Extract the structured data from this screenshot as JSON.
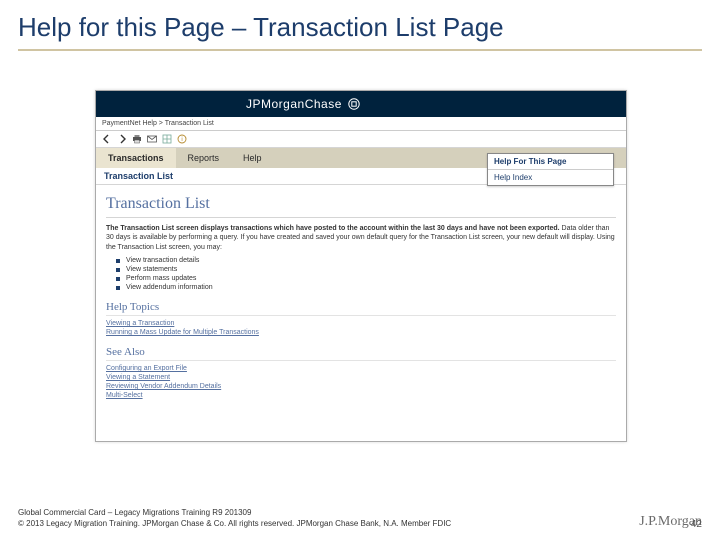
{
  "slide": {
    "title": "Help for this Page – Transaction List Page",
    "page_number": "42",
    "footer_line1": "Global Commercial Card – Legacy Migrations Training R9 201309",
    "footer_line2": "© 2013 Legacy Migration Training. JPMorgan Chase & Co. All rights reserved. JPMorgan Chase Bank, N.A. Member FDIC",
    "footer_logo": "J.P.Morgan"
  },
  "brand": {
    "text": "JPMorganChase"
  },
  "breadcrumb": "PaymentNet Help > Transaction List",
  "nav": {
    "tabs": [
      "Transactions",
      "Reports",
      "Help"
    ],
    "subtab": "Transaction List"
  },
  "help_menu": {
    "items": [
      "Help For This Page",
      "Help Index"
    ]
  },
  "page": {
    "heading": "Transaction List",
    "desc_prefix_bold": "The Transaction List screen displays transactions which have posted to the account within the last 30 days and have not been exported.",
    "desc_rest": " Data older than 30 days is available by performing a query. If you have created and saved your own default query for the Transaction List screen, your new default will display. Using the Transaction List screen, you may:",
    "bullets": [
      "View transaction details",
      "View statements",
      "Perform mass updates",
      "View addendum information"
    ],
    "help_topics_h": "Help Topics",
    "help_topics": [
      "Viewing a Transaction",
      "Running a Mass Update for Multiple Transactions"
    ],
    "see_also_h": "See Also",
    "see_also": [
      "Configuring an Export File",
      "Viewing a Statement",
      "Reviewing Vendor Addendum Details",
      "Multi-Select"
    ]
  }
}
